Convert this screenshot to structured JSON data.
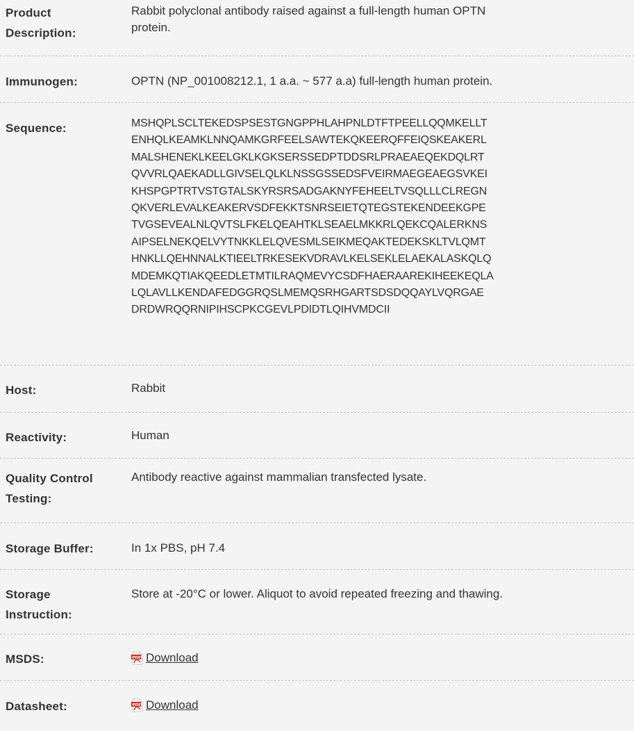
{
  "rows": {
    "product_description": {
      "label_line1": "Product",
      "label_line2": "Description:",
      "value_line1": "Rabbit polyclonal antibody raised against a full-length human OPTN",
      "value_line2": "protein."
    },
    "immunogen": {
      "label": "Immunogen:",
      "value": "OPTN (NP_001008212.1, 1 a.a. ~ 577 a.a) full-length human protein."
    },
    "sequence": {
      "label": "Sequence:",
      "lines": [
        "MSHQPLSCLTEKEDSPSESTGNGPPHLAHPNLDTFTPEELLQQMKELLT",
        "ENHQLKEAMKLNNQAMKGRFEELSAWTEKQKEERQFFEIQSKEAKERL",
        "MALSHENEKLKEELGKLKGKSERSSEDPTDDSRLPRAEAEQEKDQLRT",
        "QVVRLQAEKADLLGIVSELQLKLNSSGSSEDSFVEIRMAEGEAEGSVKEI",
        "KHSPGPTRTVSTGTALSKYRSRSADGAKNYFEHEELTVSQLLLCLREGN",
        "QKVERLEVALKEAKERVSDFEKKTSNRSEIETQTEGSTEKENDEEKGPE",
        "TVGSEVEALNLQVTSLFKELQEAHTKLSEAELMKKRLQEKCQALERKNS",
        "AIPSELNEKQELVYTNKKLELQVESMLSEIKMEQAKTEDEKSKLTVLQMT",
        "HNKLLQEHNNALKTIEELTRKESEKVDRAVLKELSEKLELAEKALASKQLQ",
        "MDEMKQTIAKQEEDLETMTILRAQMEVYCSDFHAERAAREKIHEEKEQLA",
        "LQLAVLLKENDAFEDGGRQSLMEMQSRHGARTSDSDQQAYLVQRGAE",
        "DRDWRQQRNIPIHSCPKCGEVLPDIDTLQIHVMDCII"
      ]
    },
    "host": {
      "label": "Host:",
      "value": "Rabbit"
    },
    "reactivity": {
      "label": "Reactivity:",
      "value": "Human"
    },
    "quality_control": {
      "label_line1": "Quality Control",
      "label_line2": "Testing:",
      "value": "Antibody reactive against mammalian transfected lysate."
    },
    "storage_buffer": {
      "label": "Storage Buffer:",
      "value": "In 1x PBS, pH 7.4"
    },
    "storage_instruction": {
      "label_line1": "Storage",
      "label_line2": "Instruction:",
      "value": "Store at -20°C or lower. Aliquot to avoid repeated freezing and thawing."
    },
    "msds": {
      "label": "MSDS:",
      "link_text": "Download",
      "icon": "pdf-icon"
    },
    "datasheet": {
      "label": "Datasheet:",
      "link_text": "Download",
      "icon": "pdf-icon"
    }
  },
  "colors": {
    "background": "#f4f4f4",
    "text": "#333333",
    "divider": "#c8c8c8",
    "pdf_red": "#d9281c"
  }
}
